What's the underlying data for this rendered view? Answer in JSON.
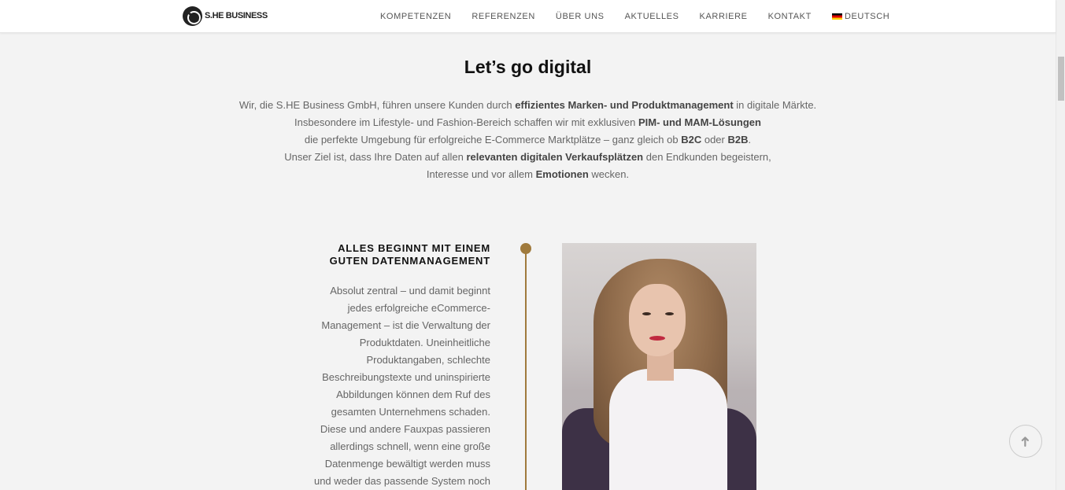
{
  "header": {
    "logo_text": "S.HE BUSINESS",
    "nav": [
      {
        "label": "KOMPETENZEN"
      },
      {
        "label": "REFERENZEN"
      },
      {
        "label": "ÜBER UNS"
      },
      {
        "label": "AKTUELLES"
      },
      {
        "label": "KARRIERE"
      },
      {
        "label": "KONTAKT"
      }
    ],
    "language": {
      "label": "DEUTSCH",
      "flag_icon": "germany-flag-icon"
    }
  },
  "intro": {
    "title": "Let’s go digital",
    "lines": [
      [
        {
          "text": "Wir, die S.HE Business GmbH, führen unsere Kunden durch ",
          "bold": false
        },
        {
          "text": "effizientes Marken- und Produktmanagement",
          "bold": true
        },
        {
          "text": " in digitale Märkte.",
          "bold": false
        }
      ],
      [
        {
          "text": "Insbesondere im Lifestyle- und Fashion-Bereich schaffen wir mit exklusiven ",
          "bold": false
        },
        {
          "text": "PIM- und MAM-Lösungen",
          "bold": true
        }
      ],
      [
        {
          "text": "die perfekte Umgebung für erfolgreiche E-Commerce Marktplätze – ganz gleich ob ",
          "bold": false
        },
        {
          "text": "B2C",
          "bold": true
        },
        {
          "text": " oder ",
          "bold": false
        },
        {
          "text": "B2B",
          "bold": true
        },
        {
          "text": ".",
          "bold": false
        }
      ],
      [
        {
          "text": "Unser Ziel ist, dass Ihre Daten auf allen ",
          "bold": false
        },
        {
          "text": "relevanten digitalen Verkaufsplätzen",
          "bold": true
        },
        {
          "text": " den Endkunden begeistern,",
          "bold": false
        }
      ],
      [
        {
          "text": "Interesse und vor allem ",
          "bold": false
        },
        {
          "text": "Emotionen",
          "bold": true
        },
        {
          "text": " wecken.",
          "bold": false
        }
      ]
    ]
  },
  "section": {
    "heading_line1": "ALLES BEGINNT MIT EINEM",
    "heading_line2": "GUTEN DATENMANAGEMENT",
    "body_lines": [
      "Absolut zentral – und damit beginnt",
      "jedes erfolgreiche eCommerce-",
      "Management – ist die Verwaltung der",
      "Produktdaten. Uneinheitliche",
      "Produktangaben, schlechte",
      "Beschreibungstexte und uninspirierte",
      "Abbildungen können dem Ruf des",
      "gesamten Unternehmens schaden.",
      "Diese und andere Fauxpas passieren",
      "allerdings schnell, wenn eine große",
      "Datenmenge bewältigt werden muss",
      "und weder das passende System noch"
    ],
    "accent_color": "#a07a3c"
  },
  "back_to_top": {
    "icon": "arrow-up-icon",
    "glyph": "➜"
  }
}
